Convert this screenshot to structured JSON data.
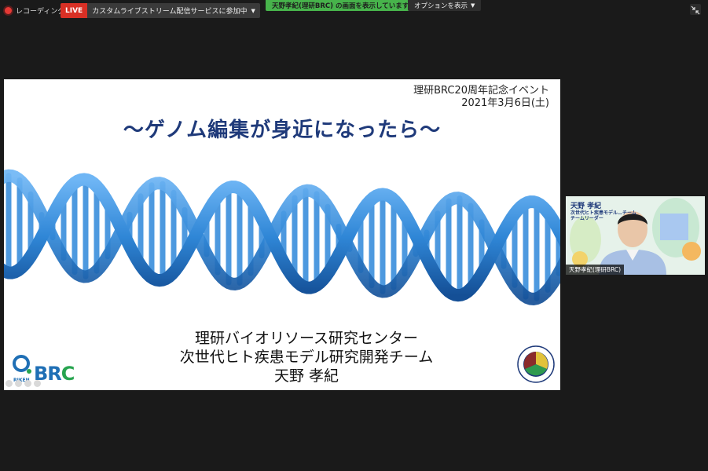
{
  "topbar": {
    "recording_label": "レコーディング中",
    "live_badge": "LIVE",
    "live_menu_label": "カスタムライブストリーム配信サービスに参加中",
    "share_banner": "天野孝紀(理研BRC) の画面を表示しています",
    "options_label": "オプションを表示"
  },
  "slide": {
    "event_line1": "理研BRC20周年記念イベント",
    "event_line2": "2021年3月6日(土)",
    "title": "～ゲノム編集が身近になったら～",
    "presenter_org": "理研バイオリソース研究センター",
    "presenter_team": "次世代ヒト疾患モデル研究開発チーム",
    "presenter_name": "天野 孝紀",
    "logo_text_br": "BR",
    "logo_text_c": "C",
    "logo_sub": "RIKEN",
    "colors": {
      "title": "#1f3a7a",
      "dna": "#2f86d6",
      "logo_blue": "#1f6fb5",
      "logo_green": "#27a44f"
    }
  },
  "video": {
    "overlay_title": "天野 孝紀",
    "overlay_sub1": "次世代ヒト疾患モデル…チーム",
    "overlay_sub2": "チームリーダー",
    "participant_name": "天野孝紀(理研BRC)"
  },
  "icons": {
    "record": "record-dot-icon",
    "caret": "chevron-down-icon",
    "exit_fullscreen": "exit-fullscreen-icon"
  }
}
